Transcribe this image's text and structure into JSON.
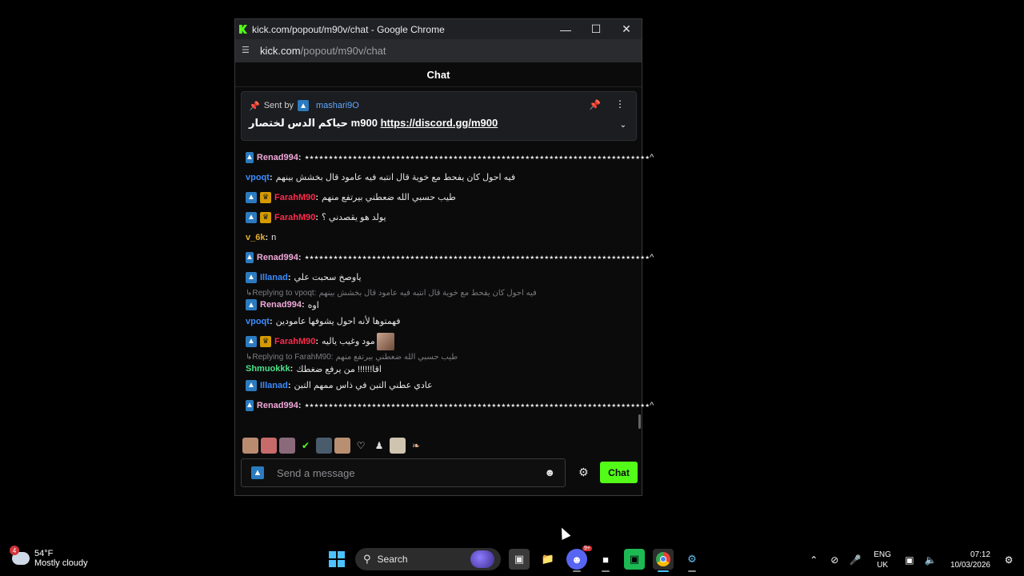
{
  "window": {
    "title": "kick.com/popout/m90v/chat - Google Chrome",
    "url_host": "kick.com",
    "url_path": "/popout/m90v/chat"
  },
  "chat": {
    "header": "Chat",
    "pinned": {
      "sent_by_label": "Sent by",
      "sender": "mashari9O",
      "text": "حياكم الدس لختصار m900",
      "link": "https://discord.gg/m900"
    },
    "messages": [
      {
        "type": "msg",
        "badges": [
          "kick"
        ],
        "user": "Renad994",
        "color": "#f0a8d8",
        "text": "٭٭٭٭٭٭٭٭٭٭٭٭٭٭٭٭٭٭٭٭٭٭٭٭٭٭٭٭٭٭٭٭٭٭٭٭٭٭٭٭٭٭٭٭٭٭٭٭٭٭٭٭٭٭٭٭٭٭٭٭٭٭٭٭٭٭٭٭٭٭٭٭^"
      },
      {
        "type": "msg",
        "badges": [],
        "user": "vpoqt",
        "color": "#3b8cff",
        "text": "فيه احول كان يفحط مع خوية قال انتبه فيه عامود قال بخشش بينهم"
      },
      {
        "type": "msg",
        "badges": [
          "kick",
          "crown"
        ],
        "user": "FarahM90",
        "color": "#ff2a4b",
        "text": "طيب حسبي الله ضعطني بيرتفع منهم"
      },
      {
        "type": "msg",
        "badges": [
          "kick",
          "crown"
        ],
        "user": "FarahM90",
        "color": "#ff2a4b",
        "text": "يولد هو يقصدني ؟"
      },
      {
        "type": "msg",
        "badges": [],
        "user": "v_6k",
        "color": "#e5b02e",
        "text": "n"
      },
      {
        "type": "msg",
        "badges": [
          "kick"
        ],
        "user": "Renad994",
        "color": "#f0a8d8",
        "text": "٭٭٭٭٭٭٭٭٭٭٭٭٭٭٭٭٭٭٭٭٭٭٭٭٭٭٭٭٭٭٭٭٭٭٭٭٭٭٭٭٭٭٭٭٭٭٭٭٭٭٭٭٭٭٭٭٭٭٭٭٭٭٭٭٭٭٭٭٭٭٭٭^"
      },
      {
        "type": "msg",
        "badges": [
          "kick"
        ],
        "user": "Illanad",
        "color": "#3b8cff",
        "text": "ياوصخ سحبت علي"
      },
      {
        "type": "reply",
        "label": "Replying to vpoqt:",
        "text": "فيه احول كان يفحط مع خوية قال انتبه فيه عامود قال بخشش بينهم"
      },
      {
        "type": "msg",
        "badges": [
          "kick"
        ],
        "user": "Renad994",
        "color": "#f0a8d8",
        "text": "اوه",
        "tight": true
      },
      {
        "type": "msg",
        "badges": [],
        "user": "vpoqt",
        "color": "#3b8cff",
        "text": "فهمتوها لأنه احول يشوفها عامودين"
      },
      {
        "type": "msg",
        "badges": [
          "kick",
          "crown"
        ],
        "user": "FarahM90",
        "color": "#ff2a4b",
        "text": "مود وغيب ياليه",
        "emote": true
      },
      {
        "type": "reply",
        "label": "Replying to FarahM90:",
        "text": "طيب حسبي الله ضعطني بيرتفع منهم"
      },
      {
        "type": "msg",
        "badges": [],
        "user": "Shmuokkk",
        "color": "#4ce08a",
        "text": "اقا!!!!!! من يرفع ضغطك",
        "tight": true
      },
      {
        "type": "msg",
        "badges": [
          "kick"
        ],
        "user": "Illanad",
        "color": "#3b8cff",
        "text": "عادي عطني التبن في ذاس ممهم التبن"
      },
      {
        "type": "msg",
        "badges": [
          "kick"
        ],
        "user": "Renad994",
        "color": "#f0a8d8",
        "text": "٭٭٭٭٭٭٭٭٭٭٭٭٭٭٭٭٭٭٭٭٭٭٭٭٭٭٭٭٭٭٭٭٭٭٭٭٭٭٭٭٭٭٭٭٭٭٭٭٭٭٭٭٭٭٭٭٭٭٭٭٭٭٭٭٭٭٭٭٭٭٭٭^"
      }
    ],
    "input_placeholder": "Send a message",
    "send_button": "Chat"
  },
  "taskbar": {
    "weather_temp": "54°F",
    "weather_desc": "Mostly cloudy",
    "weather_badge": "4",
    "search_label": "Search",
    "discord_badge": "9+",
    "lang_top": "ENG",
    "lang_bottom": "UK",
    "time": "07:12",
    "date": "10/03/2026"
  }
}
